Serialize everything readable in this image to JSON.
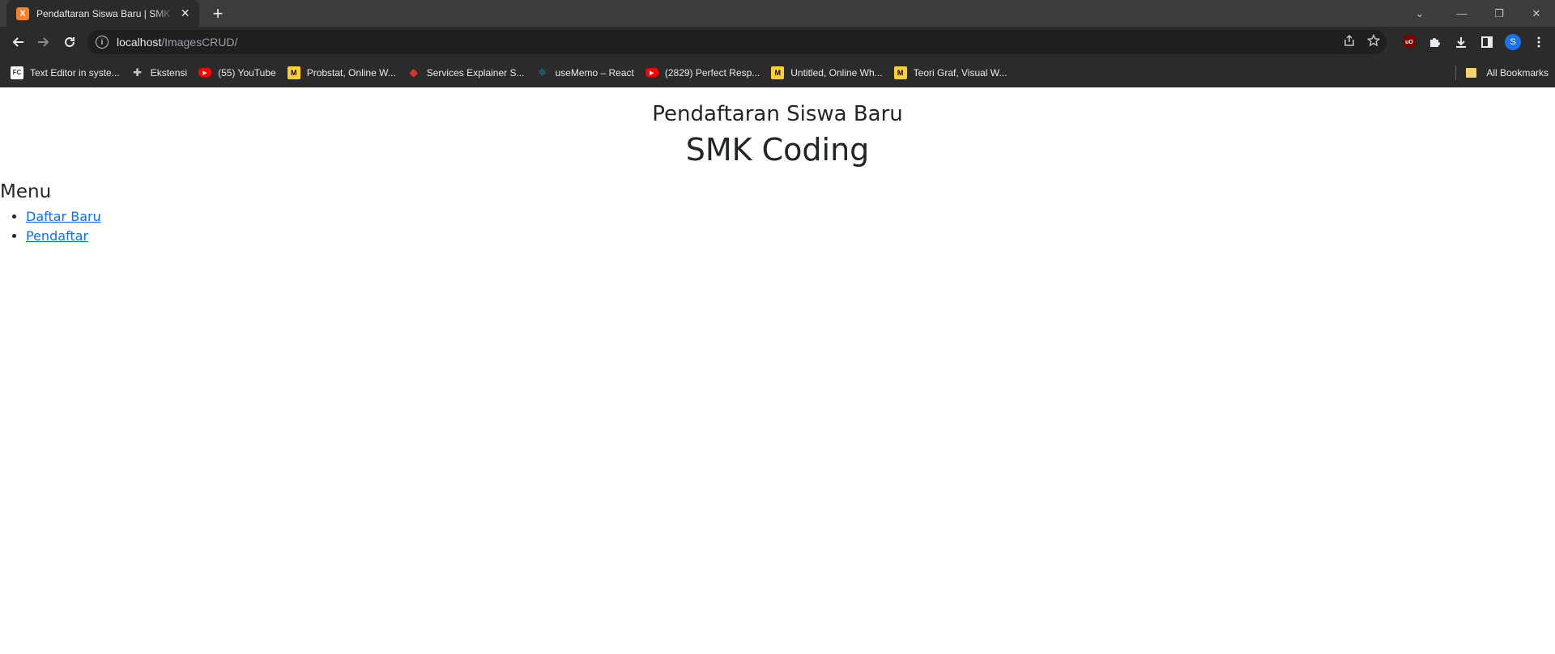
{
  "browser": {
    "tab": {
      "favicon_letter": "X",
      "title": "Pendaftaran Siswa Baru | SMK Coding",
      "close_glyph": "✕"
    },
    "new_tab_glyph": "+",
    "window_controls": {
      "tab_search": "⌄",
      "minimize": "—",
      "restore": "❐",
      "close": "✕"
    },
    "address": {
      "host": "localhost",
      "path": "/ImagesCRUD/"
    },
    "profile_initial": "S",
    "ublock_label": "uO",
    "bookmarks": [
      {
        "label": "Text Editor in syste...",
        "icon": "fc-icon",
        "glyph": "FC"
      },
      {
        "label": "Ekstensi",
        "icon": "puzzle-icon",
        "glyph": "✚"
      },
      {
        "label": "(55) YouTube",
        "icon": "youtube-icon",
        "glyph": "▶"
      },
      {
        "label": "Probstat, Online W...",
        "icon": "miro-icon",
        "glyph": "M"
      },
      {
        "label": "Services Explainer S...",
        "icon": "services-icon",
        "glyph": "◆"
      },
      {
        "label": "useMemo – React",
        "icon": "react-icon",
        "glyph": "⚛"
      },
      {
        "label": "(2829) Perfect Resp...",
        "icon": "youtube-icon",
        "glyph": "▶"
      },
      {
        "label": "Untitled, Online Wh...",
        "icon": "miro-icon",
        "glyph": "M"
      },
      {
        "label": "Teori Graf, Visual W...",
        "icon": "miro-icon",
        "glyph": "M"
      }
    ],
    "all_bookmarks": "All Bookmarks"
  },
  "page": {
    "subtitle": "Pendaftaran Siswa Baru",
    "title": "SMK Coding",
    "menu": {
      "heading": "Menu",
      "links": [
        {
          "label": "Daftar Baru"
        },
        {
          "label": "Pendaftar"
        }
      ]
    }
  }
}
